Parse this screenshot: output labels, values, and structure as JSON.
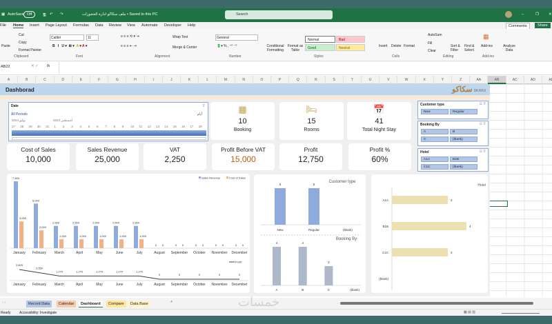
{
  "titlebar": {
    "autosave": "AutoSave",
    "autosave_state": "Off",
    "filename": "ملف سكاكو ادارة الحجوزات • Saved to this PC",
    "search_placeholder": "Search"
  },
  "ribbon_tabs": [
    "File",
    "Home",
    "Insert",
    "Page Layout",
    "Formulas",
    "Data",
    "Review",
    "View",
    "Automate",
    "Developer",
    "Help"
  ],
  "comments": "Comments",
  "share": "Share",
  "ribbon": {
    "paste": "Paste",
    "cut": "Cut",
    "copy": "Copy",
    "format_painter": "Format Painter",
    "clipboard": "Clipboard",
    "font_name": "Calibri",
    "font_size": "11",
    "font": "Font",
    "wrap_text": "Wrap Text",
    "merge_center": "Merge & Center",
    "alignment": "Alignment",
    "number_format": "General",
    "number": "Number",
    "conditional": "Conditional Formatting",
    "format_table": "Format as Table",
    "styles": "Styles",
    "style_normal": "Normal",
    "style_bad": "Bad",
    "style_good": "Good",
    "style_neutral": "Neutral",
    "insert": "Insert",
    "delete": "Delete",
    "format": "Format",
    "cells": "Cells",
    "autosum": "AutoSum",
    "fill": "Fill",
    "clear": "Clear",
    "sort_filter": "Sort & Filter",
    "find_select": "Find & Select",
    "editing": "Editing",
    "addins": "Add-ins",
    "addins_grp": "Add-ins",
    "analyze": "Analyze Data"
  },
  "formula_bar": {
    "name_box": "AB22",
    "fx": "fx",
    "value": ""
  },
  "columns": [
    "A",
    "B",
    "C",
    "D",
    "E",
    "F",
    "G",
    "H",
    "I",
    "J",
    "K",
    "L",
    "M",
    "N",
    "O",
    "P",
    "Q",
    "R",
    "S",
    "T",
    "U",
    "V",
    "W",
    "X",
    "Y",
    "Z",
    "AA",
    "AB",
    "AC",
    "AD",
    "AE"
  ],
  "selected_column": "AB",
  "dashboard": {
    "title": "Dashborad",
    "logo": "سكاكو SKAKU"
  },
  "date_slicer": {
    "title": "Date",
    "periods": "All Periods",
    "level": "أيام",
    "month1": "يوليو 2024",
    "month2": "أغسطس 2024",
    "days": [
      "27",
      "28",
      "29",
      "30",
      "31",
      "1",
      "2",
      "3",
      "4",
      "5",
      "6",
      "7",
      "8",
      "9",
      "10",
      "11",
      "12",
      "13",
      "14",
      "15",
      "16",
      "17",
      "18"
    ]
  },
  "icon_cards": [
    {
      "icon": "calendar-grid-icon",
      "value": "10",
      "label": "Booking"
    },
    {
      "icon": "bed-icon",
      "value": "15",
      "label": "Rooms"
    },
    {
      "icon": "calendar-icon",
      "value": "41",
      "label": "Total Night Stay"
    }
  ],
  "kpis": [
    {
      "label": "Cost of Sales",
      "value": "10,000"
    },
    {
      "label": "Sales Revenue",
      "value": "25,000"
    },
    {
      "label": "VAT",
      "value": "2,250"
    },
    {
      "label": "Profit Before VAT",
      "value": "15,000",
      "highlight": "#c55a11"
    },
    {
      "label": "Profit",
      "value": "12,750"
    },
    {
      "label": "Profit %",
      "value": "60%"
    }
  ],
  "slicers": [
    {
      "title": "Customer type",
      "items": [
        "New",
        "Regular"
      ]
    },
    {
      "title": "Booking By",
      "items": [
        "A",
        "B",
        "C",
        "(blank)"
      ]
    },
    {
      "title": "Hotel",
      "items": [
        "A1A",
        "B1B",
        "C1C",
        "(blank)"
      ]
    }
  ],
  "chart_data": [
    {
      "type": "bar",
      "categories": [
        "January",
        "February",
        "March",
        "April",
        "May",
        "June",
        "July",
        "August",
        "September",
        "October",
        "November",
        "December"
      ],
      "series": [
        {
          "name": "Sales Revenue",
          "color": "#8faadc",
          "values": [
            7500,
            5000,
            2500,
            2500,
            2500,
            2500,
            2500,
            0,
            0,
            0,
            0,
            0
          ]
        },
        {
          "name": "Cost of Sales",
          "color": "#f4b183",
          "values": [
            3000,
            2000,
            1000,
            1000,
            1000,
            1000,
            1000,
            0,
            0,
            0,
            0,
            0
          ]
        }
      ],
      "legend": "top-right"
    },
    {
      "type": "line",
      "categories": [
        "January",
        "February",
        "March",
        "April",
        "May",
        "June",
        "July",
        "August",
        "September",
        "October",
        "November",
        "December"
      ],
      "series": [
        {
          "name": "Profit",
          "color": "#404040",
          "values": [
            3825,
            2550,
            1275,
            1275,
            1275,
            1275,
            1275,
            0,
            0,
            0,
            0,
            0
          ]
        }
      ],
      "legend": "top-right"
    },
    {
      "type": "bar",
      "title": "Customer type",
      "categories": [
        "New",
        "Regular",
        "(blank)"
      ],
      "values": [
        5,
        5,
        0
      ],
      "color": "#8faadc"
    },
    {
      "type": "bar",
      "title": "Booking By",
      "categories": [
        "A",
        "B",
        "C",
        "(blank)"
      ],
      "values": [
        4,
        4,
        2,
        0
      ],
      "color": "#adb9ca"
    },
    {
      "type": "bar",
      "orientation": "horizontal",
      "title": "Hotel",
      "categories": [
        "A1A",
        "B1B",
        "C1C",
        "(blank)"
      ],
      "values": [
        3,
        4,
        3,
        0
      ],
      "color": "#ede0b0"
    }
  ],
  "sheet_tabs": [
    {
      "label": "Record Data",
      "color": "#b4c6e7"
    },
    {
      "label": "Calendar",
      "color": "#f8cbad"
    },
    {
      "label": "Dashboard",
      "color": "#ffffff",
      "active": true
    },
    {
      "label": "Compare",
      "color": "#ffe699"
    },
    {
      "label": "Data Base",
      "color": "#fff2cc"
    }
  ],
  "status": {
    "ready": "Ready",
    "accessibility": "Accessibility: Investigate"
  },
  "watermark": "خمسات"
}
